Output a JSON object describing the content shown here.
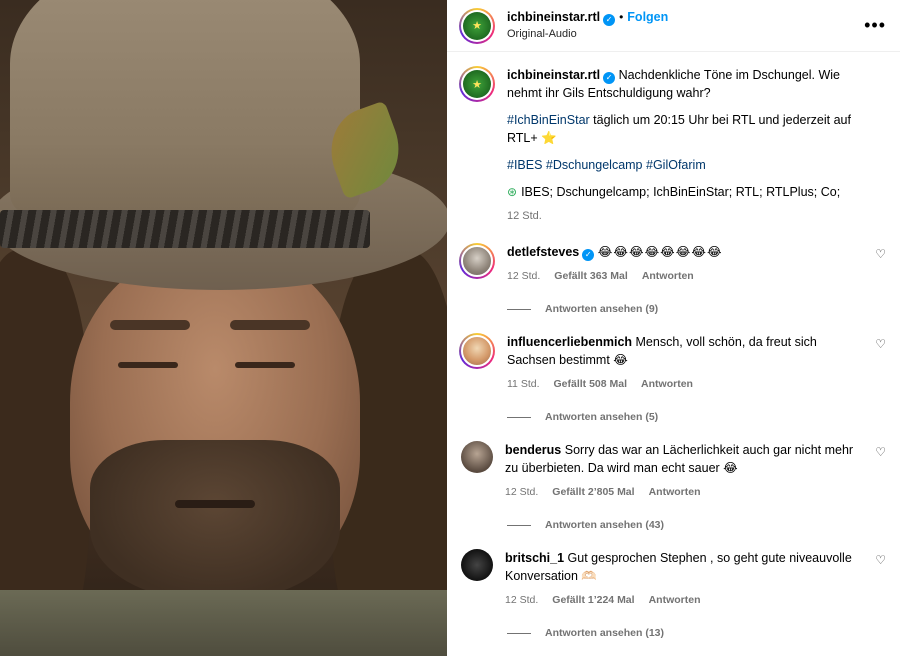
{
  "header": {
    "username": "ichbineinstar.rtl",
    "verified_icon": "verified-badge-icon",
    "separator": "•",
    "follow_label": "Folgen",
    "subtitle": "Original-Audio",
    "more_icon": "•••"
  },
  "caption": {
    "username": "ichbineinstar.rtl",
    "text": "Nachdenkliche Töne im Dschungel. Wie nehmt ihr Gils Entschuldigung wahr?",
    "line2_hashtag": "#IchBinEinStar",
    "line2_text": " täglich um 20:15 Uhr bei RTL und jederzeit auf RTL+ ⭐",
    "hashtags": [
      "#IBES",
      "#Dschungelcamp",
      "#GilOfarim"
    ],
    "audio_icon": "audio-tag-icon",
    "audio_text": "IBES; Dschungelcamp; IchBinEinStar; RTL; RTLPlus; Co;",
    "time": "12 Std."
  },
  "comments": [
    {
      "username": "detlefsteves",
      "verified": true,
      "text": "😂😂😂😂😂😂😂😂",
      "time": "12 Std.",
      "likes": "Gefällt 363 Mal",
      "reply_label": "Antworten",
      "thread": "Antworten ansehen (9)"
    },
    {
      "username": "influencerliebenmich",
      "verified": false,
      "text": "Mensch, voll schön, da freut sich Sachsen bestimmt 😂",
      "time": "11 Std.",
      "likes": "Gefällt 508 Mal",
      "reply_label": "Antworten",
      "thread": "Antworten ansehen (5)"
    },
    {
      "username": "benderus",
      "verified": false,
      "text": "Sorry das war an Lächerlichkeit auch gar nicht mehr zu überbieten. Da wird man echt sauer 😂",
      "time": "12 Std.",
      "likes": "Gefällt 2’805 Mal",
      "reply_label": "Antworten",
      "thread": "Antworten ansehen (43)"
    },
    {
      "username": "britschi_1",
      "verified": false,
      "text": "Gut gesprochen Stephen , so geht gute niveauvolle Konversation 🫶🏻",
      "time": "12 Std.",
      "likes": "Gefällt 1’224 Mal",
      "reply_label": "Antworten",
      "thread": "Antworten ansehen (13)"
    }
  ],
  "colors": {
    "link": "#0095f6",
    "hashtag": "#00376b",
    "muted": "#737373"
  }
}
